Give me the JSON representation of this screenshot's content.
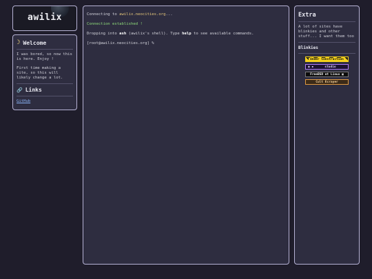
{
  "logo": {
    "title": "awilix"
  },
  "welcome": {
    "heading": "Welcome",
    "paragraph1": "I was bored, so now this is here. Enjoy !",
    "paragraph2": "First time making a site, so this will likely change a lot.",
    "links_heading": "Links",
    "github_link": "GitHub"
  },
  "terminal": {
    "line1_prefix": "Connecting to ",
    "line1_host": "awilix.neocities.org",
    "line1_suffix": "...",
    "line2": "Connection established !",
    "line3_prefix": "Dropping into ",
    "line3_ash": "ash",
    "line3_mid": " (awilix's shell). Type ",
    "line3_help": "help",
    "line3_suffix": " to see available commands.",
    "prompt": "[root@awilix.neocities.org] %"
  },
  "extra": {
    "title": "Extra",
    "description": "A lot of sites have blinkies and other stuff... I want them too",
    "blinkies_title": "Blinkies",
    "blinkies": [
      "Under Construction",
      "studio",
      "FreeBSD et Linux",
      "Cult Ecrayer"
    ]
  },
  "colors": {
    "background": "#1f1d2b",
    "panel": "#2e2d40",
    "border": "#b7b3d6",
    "host": "#e6c77a",
    "success": "#8fdc7a",
    "link": "#8ab4f8"
  }
}
